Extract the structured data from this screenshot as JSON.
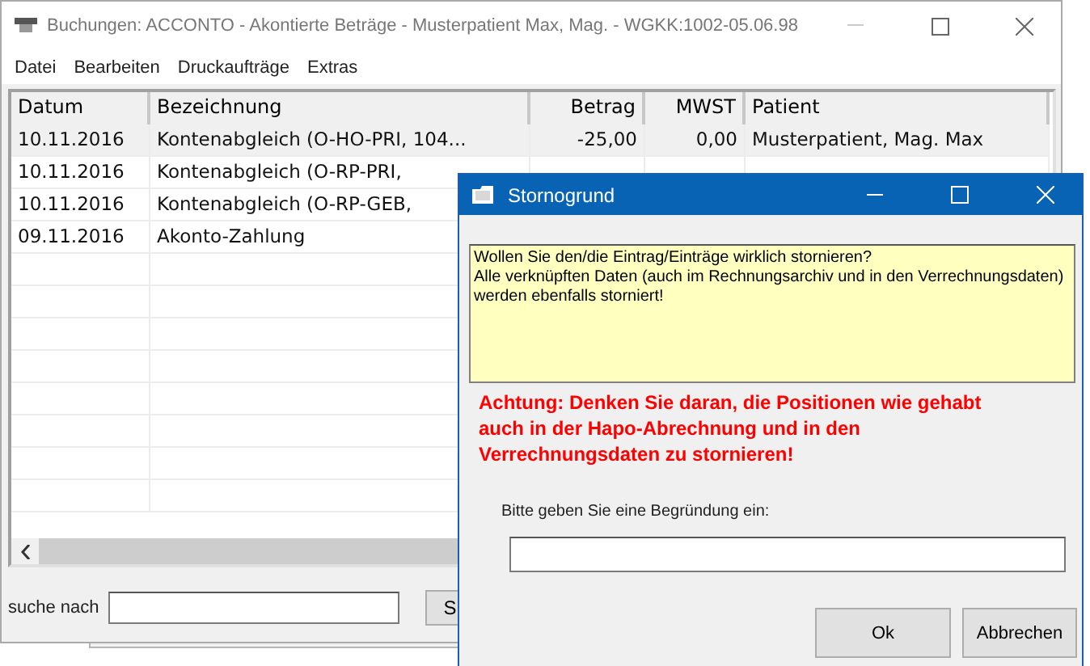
{
  "main_window": {
    "title": "Buchungen: ACCONTO - Akontierte Beträge - Musterpatient Max, Mag. - WGKK:1002-05.06.98",
    "menu": [
      "Datei",
      "Bearbeiten",
      "Druckaufträge",
      "Extras"
    ],
    "table": {
      "columns": [
        "Datum",
        "Bezeichnung",
        "Betrag",
        "MWST",
        "Patient"
      ],
      "rows": [
        {
          "selected": true,
          "cells": [
            "10.11.2016",
            "Kontenabgleich (O-HO-PRI, 104...",
            "-25,00",
            "0,00",
            "Musterpatient, Mag. Max"
          ]
        },
        {
          "selected": false,
          "cells": [
            "10.11.2016",
            "Kontenabgleich (O-RP-PRI,",
            "",
            "",
            ""
          ]
        },
        {
          "selected": false,
          "cells": [
            "10.11.2016",
            "Kontenabgleich (O-RP-GEB,",
            "",
            "",
            ""
          ]
        },
        {
          "selected": false,
          "cells": [
            "09.11.2016",
            "Akonto-Zahlung",
            "",
            "",
            ""
          ]
        }
      ]
    },
    "search": {
      "label": "suche nach",
      "button": "S"
    }
  },
  "dialog": {
    "title": "Stornogrund",
    "message": "Wollen Sie den/die Eintrag/Einträge wirklich stornieren?\nAlle verknüpften Daten (auch im Rechnungsarchiv und in den Verrechnungsdaten) werden ebenfalls storniert!",
    "warning": "Achtung: Denken Sie daran, die Positionen wie gehabt auch in der Hapo-Abrechnung und in den Verrechnungsdaten zu stornieren!",
    "reason_label": "Bitte geben Sie eine Begründung ein:",
    "buttons": [
      "Ok",
      "Abbrechen"
    ]
  }
}
